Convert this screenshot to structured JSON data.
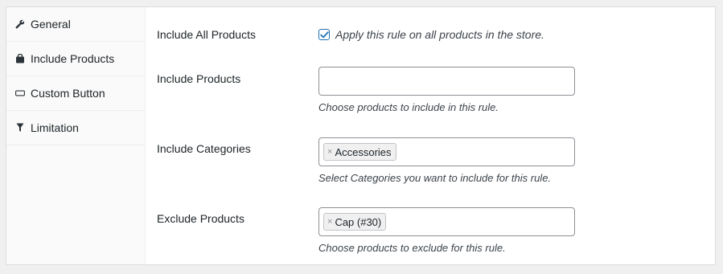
{
  "sidebar": {
    "items": [
      {
        "label": "General",
        "icon": "wrench-icon"
      },
      {
        "label": "Include Products",
        "icon": "bag-icon"
      },
      {
        "label": "Custom Button",
        "icon": "button-icon"
      },
      {
        "label": "Limitation",
        "icon": "filter-icon"
      }
    ]
  },
  "form": {
    "include_all": {
      "label": "Include All Products",
      "checked": true,
      "checkbox_label": "Apply this rule on all products in the store."
    },
    "include_products": {
      "label": "Include Products",
      "value": "",
      "description": "Choose products to include in this rule."
    },
    "include_categories": {
      "label": "Include Categories",
      "tokens": [
        "Accessories"
      ],
      "description": "Select Categories you want to include for this rule."
    },
    "exclude_products": {
      "label": "Exclude Products",
      "tokens": [
        "Cap (#30)"
      ],
      "description": "Choose products to exclude for this rule."
    }
  },
  "colors": {
    "accent": "#2271b1",
    "sidebar_bg": "#fafafa",
    "page_bg": "#f0f0f1"
  }
}
